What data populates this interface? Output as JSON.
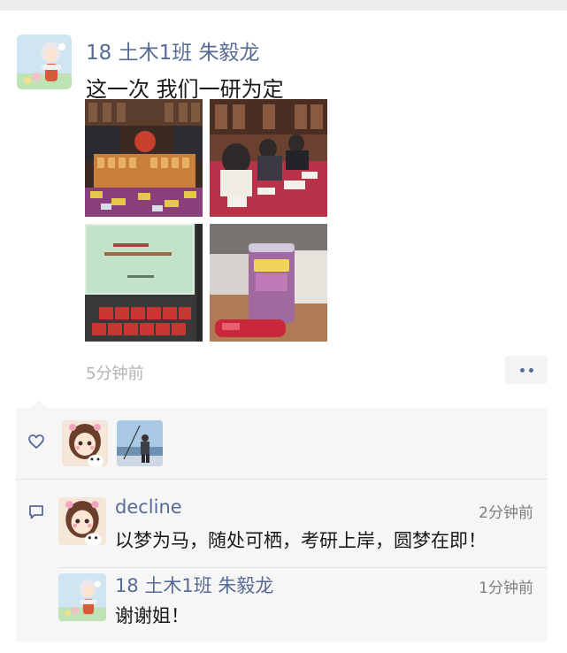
{
  "post": {
    "author": "18 土木1班 朱毅龙",
    "text": "这一次 我们一研为定",
    "time": "5分钟前",
    "photos": [
      "photo-party-snacks",
      "photo-students-writing",
      "photo-projector-screen",
      "photo-milk-tea-cup"
    ]
  },
  "likes": {
    "icon": "heart-outline-icon",
    "avatars": [
      "avatar-cartoon-girl",
      "avatar-person-fishing"
    ]
  },
  "comments": [
    {
      "author": "decline",
      "time": "2分钟前",
      "text": "以梦为马，随处可栖，考研上岸，圆梦在即！"
    },
    {
      "author": "18 土木1班 朱毅龙",
      "time": "1分钟前",
      "text": "谢谢姐！"
    }
  ]
}
